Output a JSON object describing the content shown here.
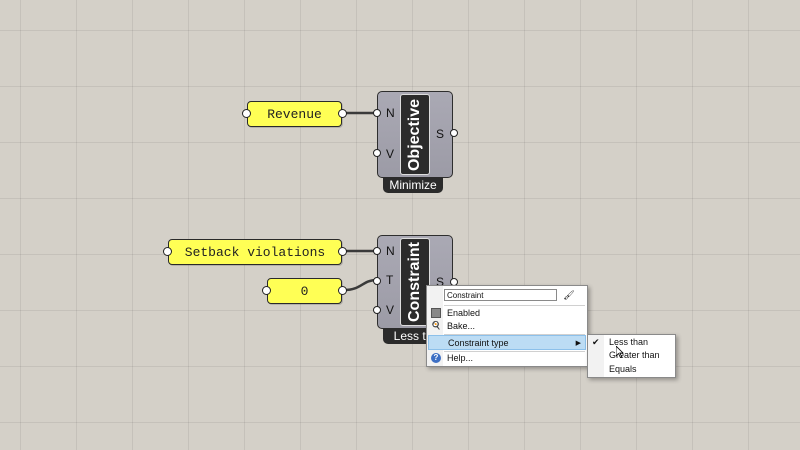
{
  "panels": {
    "revenue": "Revenue",
    "setback": "Setback violations",
    "zero": "0"
  },
  "objective": {
    "inputs": [
      "N",
      "V"
    ],
    "output": "S",
    "core_label": "Objective",
    "tag": "Minimize"
  },
  "constraint": {
    "inputs": [
      "N",
      "T",
      "V"
    ],
    "output": "S",
    "core_label": "Constraint",
    "tag": "Less th"
  },
  "context_menu": {
    "name_field": "Constraint",
    "items": {
      "enabled": "Enabled",
      "bake": "Bake...",
      "constraint_type": "Constraint type",
      "help": "Help..."
    }
  },
  "submenu": {
    "options": [
      "Less than",
      "Greater than",
      "Equals"
    ],
    "selected": "Less than"
  },
  "colors": {
    "canvas": "#d4d0c8",
    "panel": "#ffff55",
    "component": "#a4a3ae",
    "highlight": "#bcdcf4"
  }
}
